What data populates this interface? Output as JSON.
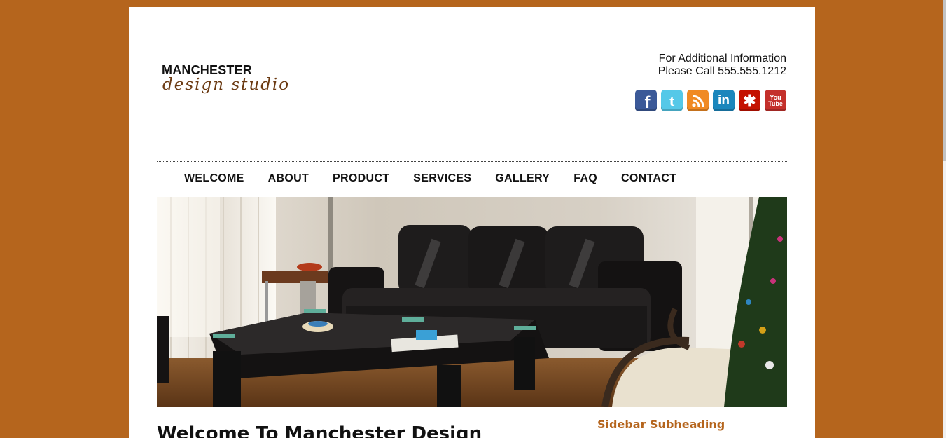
{
  "colors": {
    "background": "#b5651d",
    "page": "#ffffff",
    "accent": "#b5651d"
  },
  "logo": {
    "line1": "MANCHESTER",
    "line2": "design studio"
  },
  "contact": {
    "line1": "For Additional Information",
    "line2": "Please Call 555.555.1212"
  },
  "social": [
    {
      "name": "facebook-icon",
      "glyph": "f",
      "color": "#3b5998"
    },
    {
      "name": "twitter-icon",
      "glyph": "t",
      "color": "#55c8e8"
    },
    {
      "name": "rss-icon",
      "glyph": "",
      "color": "#f08a24"
    },
    {
      "name": "linkedin-icon",
      "glyph": "in",
      "color": "#1b86bc"
    },
    {
      "name": "yelp-icon",
      "glyph": "✱",
      "color": "#c41200"
    },
    {
      "name": "youtube-icon",
      "glyph": "You Tube",
      "color": "#c4302b"
    }
  ],
  "nav": [
    {
      "label": "WELCOME"
    },
    {
      "label": "ABOUT"
    },
    {
      "label": "PRODUCT"
    },
    {
      "label": "SERVICES"
    },
    {
      "label": "GALLERY"
    },
    {
      "label": "FAQ"
    },
    {
      "label": "CONTACT"
    }
  ],
  "main": {
    "heading": "Welcome To Manchester Design"
  },
  "sidebar": {
    "subheading": "Sidebar Subheading"
  }
}
